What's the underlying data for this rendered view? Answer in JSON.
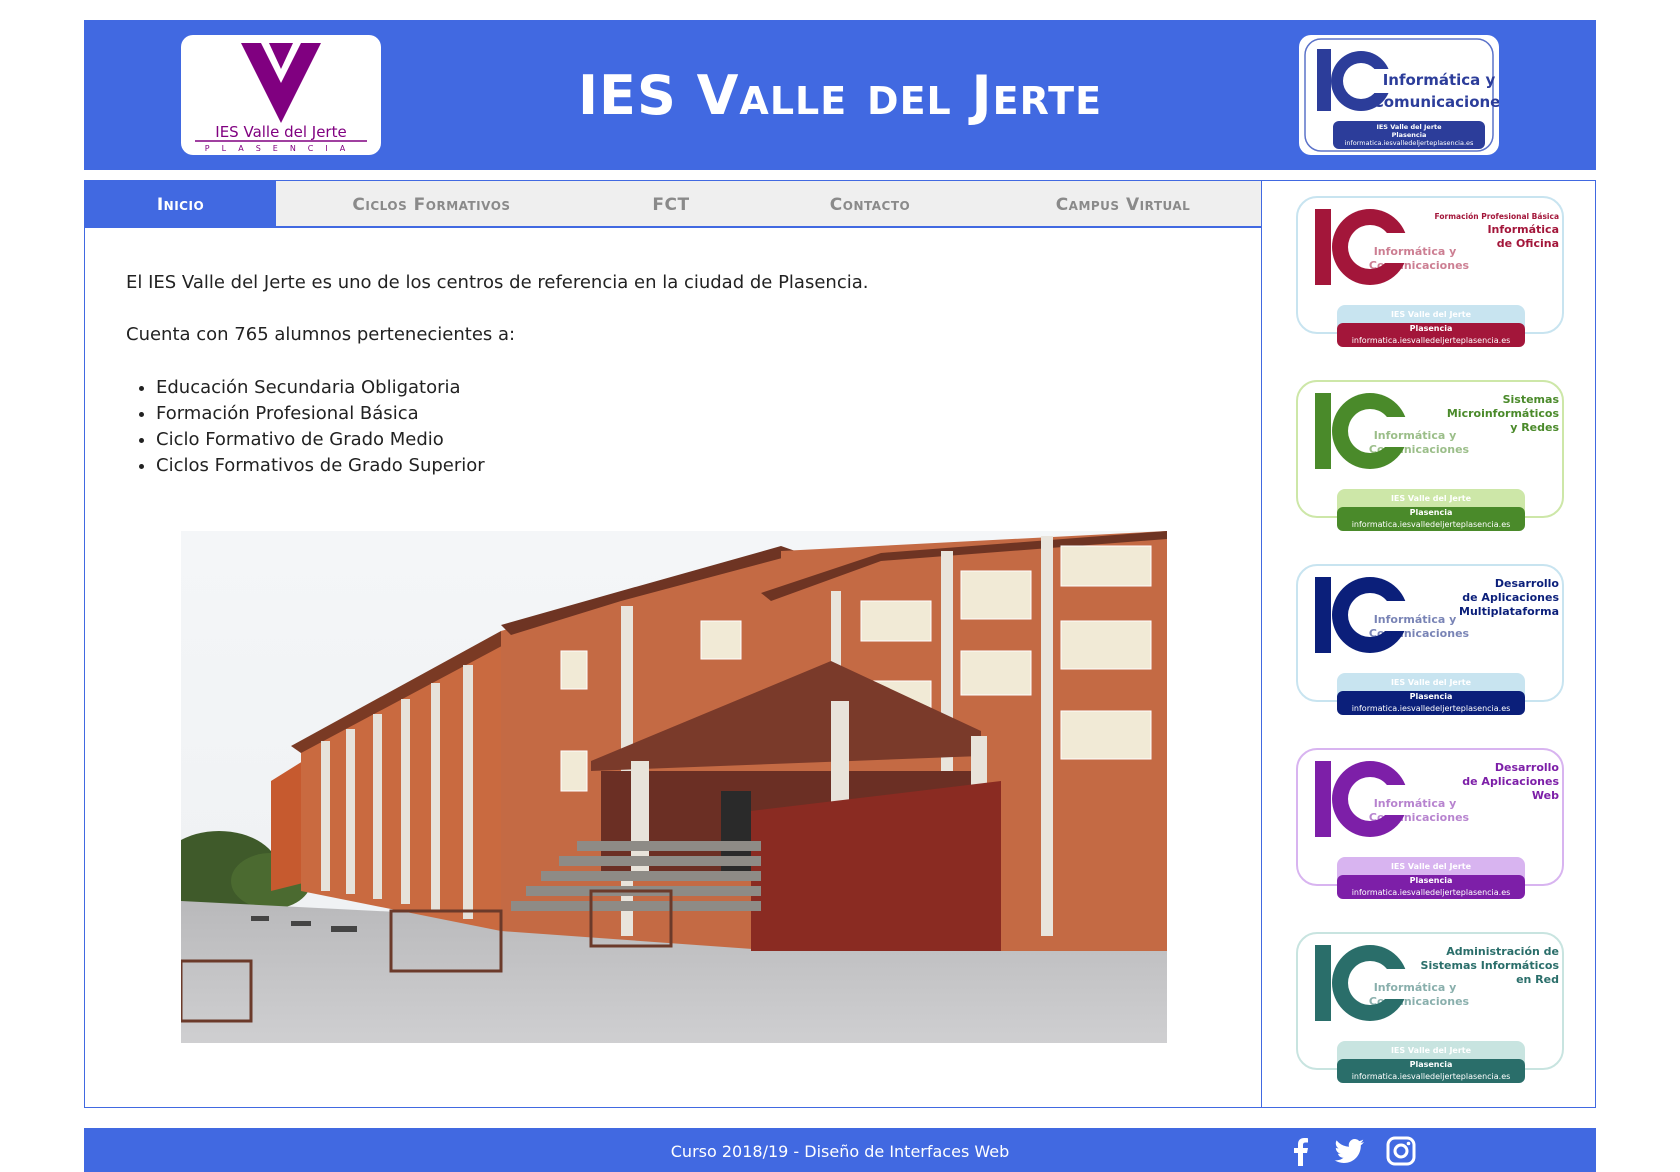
{
  "header": {
    "title": "IES Valle del Jerte",
    "school_logo": {
      "name": "school-logo",
      "letter": "V",
      "text": "IES Valle del Jerte",
      "subtext": "PLASENCIA",
      "color": "#800080"
    },
    "ic_logo": {
      "line1": "Informática y",
      "line2": "Comunicaciones",
      "footer1": "IES Valle del Jerte",
      "footer2": "Plasencia",
      "footer3": "informatica.iesvalledeljerteplasencia.es"
    }
  },
  "nav": {
    "items": [
      {
        "label": "Inicio",
        "active": true
      },
      {
        "label": "Ciclos Formativos",
        "active": false
      },
      {
        "label": "FCT",
        "active": false
      },
      {
        "label": "Contacto",
        "active": false
      },
      {
        "label": "Campus Virtual",
        "active": false
      }
    ]
  },
  "content": {
    "intro": "El IES Valle del Jerte es uno de los centros de referencia en la ciudad de Plasencia.",
    "students": "Cuenta con 765 alumnos pertenecientes a:",
    "list": [
      "Educación Secundaria Obligatoria",
      "Formación Profesional Básica",
      "Ciclo Formativo de Grado Medio",
      "Ciclos Formativos de Grado Superior"
    ],
    "photo": "school-building-photo"
  },
  "sidebar": {
    "cards": [
      {
        "title_lines": [
          "Formación Profesional Básica",
          "Informática",
          "de Oficina"
        ],
        "color": "#a3163a",
        "light": "#c8e4f0"
      },
      {
        "title_lines": [
          "Sistemas",
          "Microinformáticos",
          "y Redes"
        ],
        "color": "#4a8a2a",
        "light": "#cde7a8"
      },
      {
        "title_lines": [
          "Desarrollo",
          "de Aplicaciones",
          "Multiplataforma"
        ],
        "color": "#0b1f7a",
        "light": "#c8e4f0"
      },
      {
        "title_lines": [
          "Desarrollo",
          "de Aplicaciones",
          "Web"
        ],
        "color": "#7d1fa8",
        "light": "#d8b4f0"
      },
      {
        "title_lines": [
          "Administración de",
          "Sistemas Informáticos",
          "en Red"
        ],
        "color": "#2a6e6a",
        "light": "#c8e4e0"
      }
    ],
    "card_logo": {
      "line1": "Informática y",
      "line2": "Comunicaciones",
      "footer1": "IES Valle del Jerte",
      "footer2": "Plasencia",
      "footer3": "informatica.iesvalledeljerteplasencia.es"
    }
  },
  "footer": {
    "text": "Curso 2018/19 - Diseño de Interfaces Web",
    "social": [
      "facebook-icon",
      "twitter-icon",
      "instagram-icon"
    ]
  }
}
